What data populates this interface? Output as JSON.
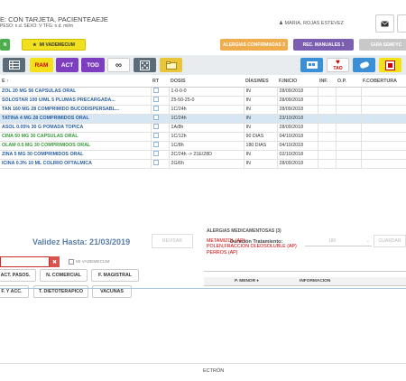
{
  "patient": {
    "name_line": "E: CON TARJETA, PACIENTEAEJE",
    "sub_line": "PESO: n.d. SEXO: V TFG: n.d. ml/m",
    "user": "MARIA, ROJAS ESTEVEZ"
  },
  "bar2": {
    "left_btn": "N",
    "vademecum_btn": "MI VADEMECUM",
    "alergias_btn": "ALERGIAS CONFIRMADAS 3",
    "manuales_btn": "REC. MANUALES 1",
    "guia_btn": "GUÍA SEMFYC",
    "colors": {
      "green": "#4cae4c",
      "yellow": "#f0e020",
      "orange": "#f0ad4e",
      "purple": "#7d5fb2",
      "grey": "#c8c8c8"
    }
  },
  "toolbar": {
    "ram": "RAM",
    "act": "ACT",
    "tod": "TOD",
    "tao": "TAO",
    "icons": [
      "table-icon",
      "link-icon",
      "dice-icon",
      "folder-icon",
      "screen-icon",
      "heart-icon",
      "pill-icon",
      "box-icon"
    ]
  },
  "medtable": {
    "headers": [
      "E ↑",
      "RT",
      "DOSIS",
      "DÍAS/MES",
      "F.INICIO",
      "INF.",
      "O.P.",
      "F.COBERTURA"
    ],
    "rows": [
      {
        "drug": "ZOL 20 MG 56 CAPSULAS ORAL",
        "dosis": "1-0-0-0",
        "dias": "IN",
        "inicio": "28/09/2018",
        "color": "#2a5f9e",
        "selected": false
      },
      {
        "drug": " SOLOSTAR 100 U/ML 5 PLUMAS PRECARGADA...",
        "dosis": "25-50-25-0",
        "dias": "IN",
        "inicio": "28/09/2018",
        "color": "#2a5f9e",
        "selected": false
      },
      {
        "drug": "TAN 160 MG 28 COMPRIMIDO BUCODISPERSABL...",
        "dosis": "1C/24h",
        "dias": "IN",
        "inicio": "28/09/2018",
        "color": "#2a5f9e",
        "selected": false
      },
      {
        "drug": "TATINA 4 MG 28 COMPRIMIDOS ORAL",
        "dosis": "1C/24h",
        "dias": "IN",
        "inicio": "23/10/2018",
        "color": "#2a5f9e",
        "selected": true
      },
      {
        "drug": "ASOL 0.05% 30 G POMADA TOPICA",
        "dosis": "1A/8h",
        "dias": "IN",
        "inicio": "28/09/2018",
        "color": "#2a5f9e",
        "selected": false
      },
      {
        "drug": "CINA 50 MG 30 CAPSULAS ORAL",
        "dosis": "1C/12h",
        "dias": "90 DIAS",
        "inicio": "04/10/2018",
        "color": "#3a9a3a",
        "selected": false
      },
      {
        "drug": "OLAM 0.5 MG 30 COMPRIMIDOS ORAL",
        "dosis": "1C/8h",
        "dias": "180 DIAS",
        "inicio": "04/10/2018",
        "color": "#3a9a3a",
        "selected": false
      },
      {
        "drug": "ZINA 5 MG 30 COMPRIMIDOS ORAL",
        "dosis": "2C/24h -> 21E/28D",
        "dias": "IN",
        "inicio": "02/10/2018",
        "color": "#2a5f9e",
        "selected": false
      },
      {
        "drug": "ICINA 0.3% 10 ML COLIRIO OFTALMICA",
        "dosis": "2G/6h",
        "dias": "IN",
        "inicio": "28/09/2018",
        "color": "#2a5f9e",
        "selected": false
      }
    ]
  },
  "lower": {
    "validez": "Validez Hasta:  21/03/2019",
    "revisar": "REVISAR",
    "duracion_label": "Duración Tratamiento:",
    "duracion_value": "180",
    "guardar": "GUARDAR",
    "search_value": "",
    "mivademecum": "MI VADEMECUM",
    "buttons": {
      "act_pasos": "ACT. PASOS.",
      "n_comercial": "N. COMERCIAL",
      "f_magistral": "F. MAGISTRAL",
      "f_acc": "F. Y ACC.",
      "t_diet": "T. DIETOTERÁPICO",
      "vacunas": "VACUNAS"
    },
    "alergias_title": "ALERGIAS MEDICAMENTOSAS (3)",
    "alergias": [
      "METAMIZOL (AP)",
      "POLEN,FRACCION OLEOSOLUBLE (AP)",
      "PERROS (AP)"
    ],
    "pmenor_headers": [
      "P. MENOR ♦",
      "INFORMACION"
    ]
  },
  "footer": {
    "text": "ECTRÓN"
  }
}
